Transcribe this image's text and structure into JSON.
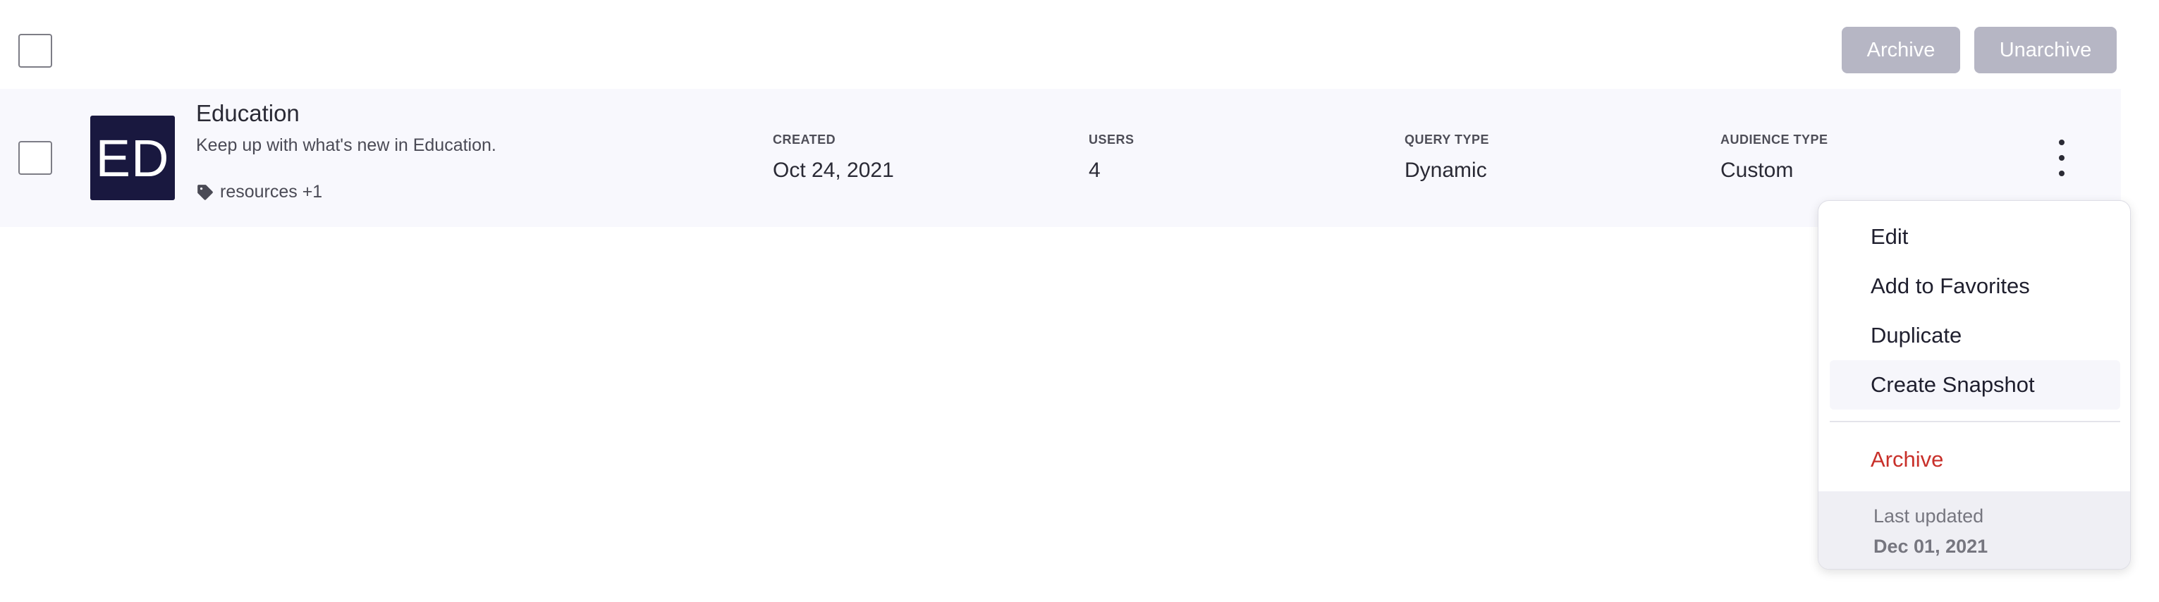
{
  "toolbar": {
    "archive_label": "Archive",
    "unarchive_label": "Unarchive"
  },
  "row": {
    "avatar_initials": "ED",
    "avatar_color": "#19183f",
    "title": "Education",
    "description": "Keep up with what's new in Education.",
    "tag_icon": "tag-icon",
    "tags": "resources +1",
    "columns": [
      {
        "label": "CREATED",
        "value": "Oct 24, 2021"
      },
      {
        "label": "USERS",
        "value": "4"
      },
      {
        "label": "QUERY TYPE",
        "value": "Dynamic"
      },
      {
        "label": "AUDIENCE TYPE",
        "value": "Custom"
      }
    ]
  },
  "menu": {
    "items": [
      {
        "label": "Edit"
      },
      {
        "label": "Add to Favorites"
      },
      {
        "label": "Duplicate"
      },
      {
        "label": "Create Snapshot"
      }
    ],
    "danger_item": "Archive",
    "danger_color": "#c8302a",
    "footer_label": "Last updated",
    "footer_date": "Dec 01, 2021"
  },
  "colors": {
    "disabled_button": "#b6b6c4",
    "row_background": "#f8f8fd"
  }
}
